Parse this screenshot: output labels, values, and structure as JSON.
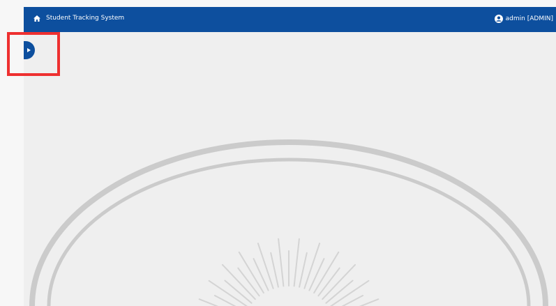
{
  "topbar": {
    "home_icon": "home-icon",
    "title": "Student Tracking System",
    "user_icon": "user-circle-icon",
    "user_label": "admin  [ADMIN]",
    "background_color": "#0d4f9e"
  },
  "sidebar": {
    "toggle_icon": "chevron-right-icon"
  },
  "annotation": {
    "highlight_color": "#ee3030"
  },
  "content": {
    "background_color": "#efefef",
    "watermark": "emblem-watermark"
  }
}
